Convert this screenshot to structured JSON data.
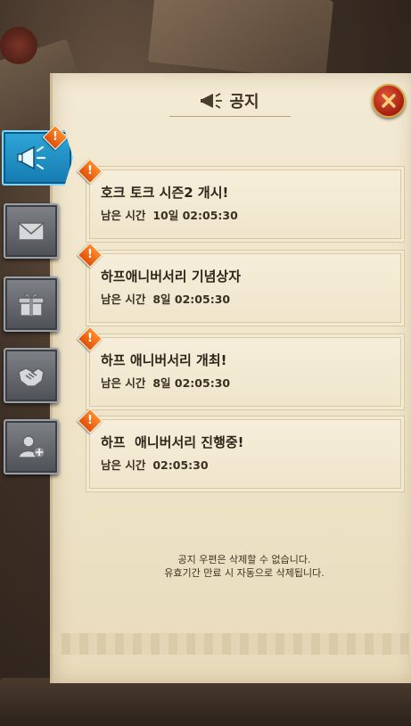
{
  "header": {
    "title": "공지",
    "title_icon": "megaphone-icon",
    "close_icon": "close-x-icon"
  },
  "tabs": [
    {
      "name": "notice",
      "icon": "megaphone-icon",
      "active": true,
      "has_alert": true
    },
    {
      "name": "mail",
      "icon": "envelope-icon",
      "active": false,
      "has_alert": false
    },
    {
      "name": "gift",
      "icon": "gift-box-icon",
      "active": false,
      "has_alert": false
    },
    {
      "name": "friendship",
      "icon": "handshake-icon",
      "active": false,
      "has_alert": false
    },
    {
      "name": "friend-add",
      "icon": "add-friend-icon",
      "active": false,
      "has_alert": false
    }
  ],
  "alert_mark": "!",
  "notices": [
    {
      "title": "호크 토크 시즌2 개시!",
      "time_label": "남은 시간",
      "time_value": "10일 02:05:30"
    },
    {
      "title": "하프애니버서리 기념상자",
      "time_label": "남은 시간",
      "time_value": "8일 02:05:30"
    },
    {
      "title": "하프 애니버서리 개최!",
      "time_label": "남은 시간",
      "time_value": "8일 02:05:30"
    },
    {
      "title": "하프  애니버서리 진행중!",
      "time_label": "남은 시간",
      "time_value": "02:05:30"
    }
  ],
  "footer": {
    "line1": "공지 우편은 삭제할 수 없습니다.",
    "line2": "유효기간 만료 시 자동으로 삭제됩니다."
  },
  "colors": {
    "active_tab": "#1f8fc4",
    "alert": "#f06a1a",
    "close_button": "#c2301a",
    "paper": "#f1e7cd"
  }
}
